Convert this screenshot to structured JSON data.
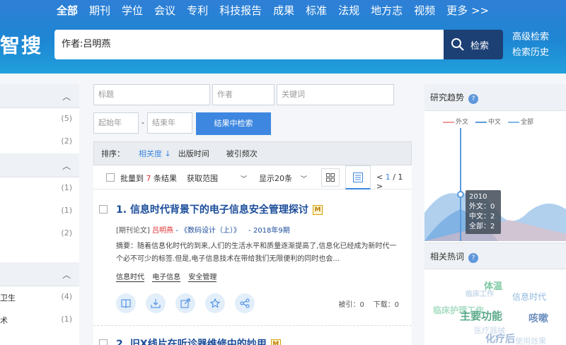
{
  "nav": {
    "items": [
      "全部",
      "期刊",
      "学位",
      "会议",
      "专利",
      "科技报告",
      "成果",
      "标准",
      "法规",
      "地方志",
      "视频",
      "更多 >>"
    ],
    "active_index": 0
  },
  "logo": "智搜",
  "search": {
    "query": "作者:吕明燕",
    "button_label": "检索"
  },
  "header_links": {
    "advanced": "高级检索",
    "history": "检索历史"
  },
  "left_panel": {
    "group1": {
      "counts": [
        "(5)",
        "(2)"
      ]
    },
    "group2": {
      "counts": [
        "(1)",
        "(1)",
        "(2)"
      ]
    },
    "group3": {
      "items": [
        {
          "label": "卫生",
          "count": "(4)"
        },
        {
          "label": "术",
          "count": "(1)"
        }
      ]
    }
  },
  "filters": {
    "title_placeholder": "标题",
    "author_placeholder": "作者",
    "keyword_placeholder": "关键词",
    "start_year_placeholder": "起始年",
    "dash": "-",
    "end_year_placeholder": "结束年",
    "search_in_results": "结果中检索"
  },
  "sort": {
    "label": "排序：",
    "relevance": "相关度",
    "relevance_arrow": "↓",
    "pub_time": "出版时间",
    "cited": "被引频次"
  },
  "toolbar": {
    "batch_text_a": "批量",
    "batch_text_b": "到",
    "selected_count": "7",
    "batch_text_c": "条结果",
    "range_label": "获取范围",
    "per_page": "显示20条",
    "pager_prev": "<",
    "pager_current": "1",
    "pager_total": "/ 1",
    "pager_next": ">"
  },
  "results": [
    {
      "index": "1.",
      "title": "信息时代背景下的电子信息安全管理探讨",
      "badge": "M",
      "type": "[期刊论文]",
      "author": "吕明燕",
      "source": "- 《数码设计（上）》",
      "date": "- 2018年9期",
      "abstract": "摘要：随着信息化时代的到来,人们的生活水平和质量逐渐提高了,信息化已经成为新时代一个必不可少的标签.但是,电子信息技术在带给我们无限便利的同时也会...",
      "keywords": [
        "信息时代",
        "电子信息",
        "安全管理"
      ],
      "cited": "被引：0",
      "downloads": "下载：0"
    },
    {
      "index": "2.",
      "title": "旧X线片在听诊器维修中的妙用",
      "badge": "M"
    }
  ],
  "right_panel": {
    "trend_title": "研究趋势",
    "legend": [
      {
        "name": "外文",
        "color": "#f29c9c"
      },
      {
        "name": "中文",
        "color": "#5b9bdc"
      },
      {
        "name": "全部",
        "color": "#7fb8e8"
      }
    ],
    "tooltip": {
      "year": "2010",
      "foreign": "外文：0",
      "chinese": "中文：2",
      "all": "全部：2"
    },
    "hot_title": "相关热词",
    "tags": [
      {
        "text": "体温",
        "color": "#7fc9a3"
      },
      {
        "text": "临床工作",
        "color": "#c9d9ea"
      },
      {
        "text": "信息时代",
        "color": "#8fb8dd"
      },
      {
        "text": "临床护理工作",
        "color": "#a9dcc3"
      },
      {
        "text": "主要功能",
        "color": "#5aa98a"
      },
      {
        "text": "咳嗽",
        "color": "#6d8fbf"
      },
      {
        "text": "医疗器械",
        "color": "#c9d9ea"
      },
      {
        "text": "化疗后",
        "color": "#9fb7d6"
      },
      {
        "text": "使用效果",
        "color": "#c9d9ea"
      }
    ]
  },
  "colors": {
    "brand": "#1e86d3",
    "accent": "#3e87e0",
    "button_dark": "#1c3f74"
  }
}
